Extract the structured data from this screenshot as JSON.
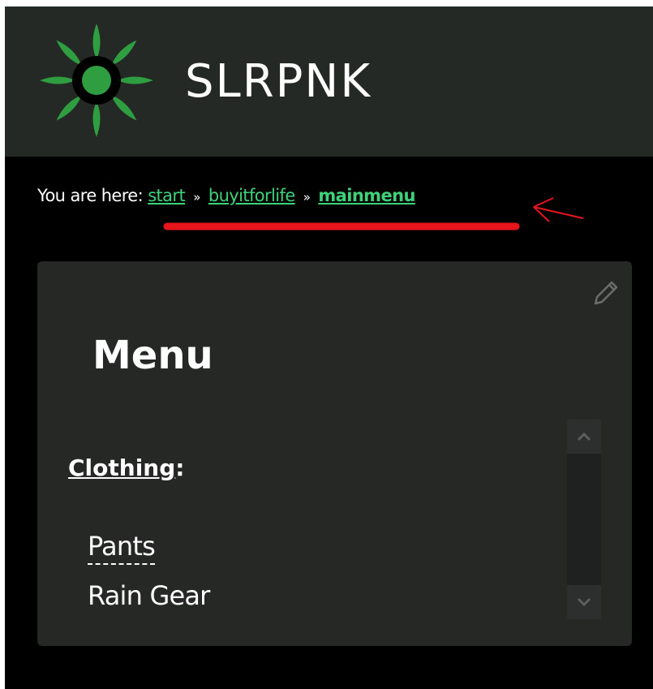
{
  "site": {
    "title": "SLRPNK",
    "logo_icon": "sun-logo-icon",
    "colors": {
      "header_bg": "#252926",
      "accent_green": "#3ed27a",
      "logo_green": "#2e9e40"
    }
  },
  "breadcrumb": {
    "prefix": "You are here:",
    "separator": "»",
    "items": [
      {
        "label": "start"
      },
      {
        "label": "buyitforlife"
      },
      {
        "label": "mainmenu"
      }
    ]
  },
  "annotation": {
    "color": "#e8151d",
    "shapes": [
      "underline",
      "arrow-icon"
    ]
  },
  "panel": {
    "edit_icon": "pencil-icon",
    "heading": "Menu",
    "section": {
      "label": "Clothing",
      "suffix": ":"
    },
    "items": [
      {
        "label": "Pants"
      },
      {
        "label": "Rain Gear"
      }
    ],
    "scroll_icons": [
      "chevron-up-icon",
      "chevron-down-icon"
    ]
  }
}
